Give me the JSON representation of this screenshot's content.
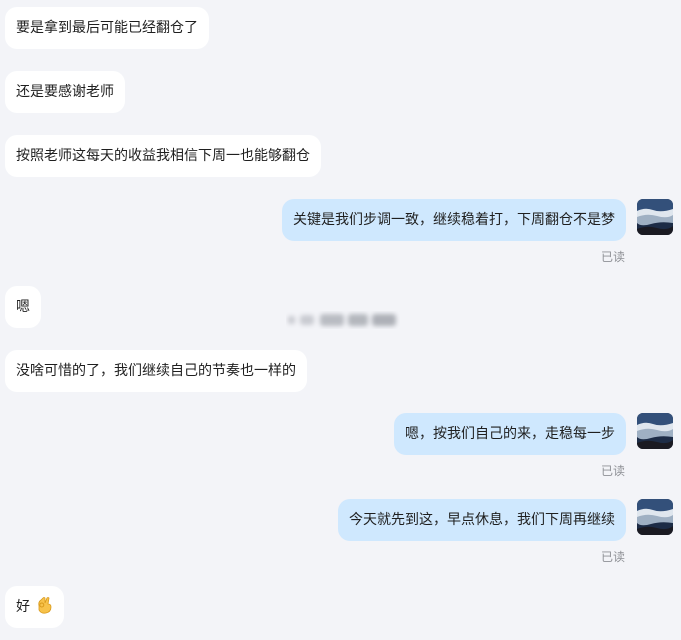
{
  "messages": [
    {
      "text": "要是拿到最后可能已经翻仓了"
    },
    {
      "text": "还是要感谢老师"
    },
    {
      "text": "按照老师这每天的收益我相信下周一也能够翻仓"
    },
    {
      "text": "关键是我们步调一致，继续稳着打，下周翻仓不是梦",
      "status": "已读"
    },
    {
      "text": "嗯"
    },
    {
      "text": "没啥可惜的了，我们继续自己的节奏也一样的"
    },
    {
      "text": "嗯，按我们自己的来，走稳每一步",
      "status": "已读"
    },
    {
      "text": "今天就先到这，早点休息，我们下周再继续",
      "status": "已读"
    },
    {
      "text": "好",
      "emoji": "ok-hand-icon"
    }
  ],
  "colors": {
    "background": "#f3f4f8",
    "incoming_bubble": "#ffffff",
    "outgoing_bubble": "#cfe8fe",
    "read_status": "#8f9196"
  }
}
